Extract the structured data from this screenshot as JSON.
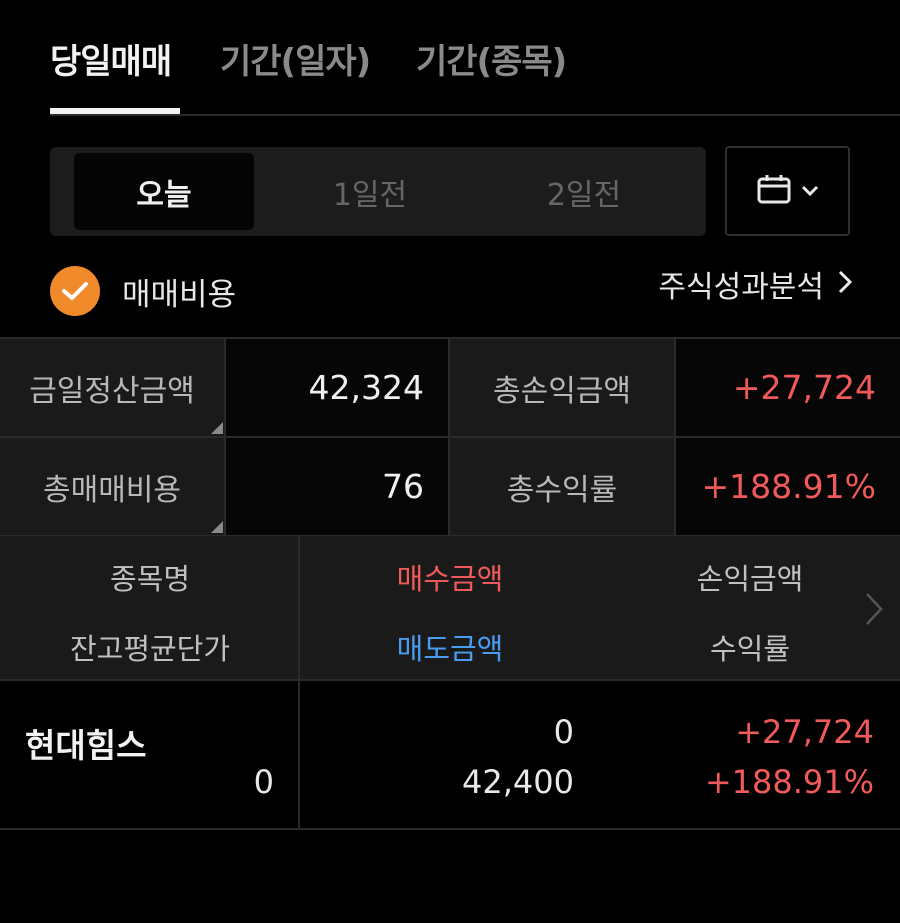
{
  "tabs": [
    {
      "label": "당일매매",
      "active": true
    },
    {
      "label": "기간(일자)",
      "active": false
    },
    {
      "label": "기간(종목)",
      "active": false
    }
  ],
  "day_selector": {
    "options": [
      "오늘",
      "1일전",
      "2일전"
    ],
    "selected": "오늘"
  },
  "calendar_button": {
    "icon": "calendar-icon",
    "chevron_icon": "chevron-down-icon"
  },
  "fee_option": {
    "label": "매매비용",
    "checked": true,
    "check_color": "#f08a2a"
  },
  "analysis_link": {
    "label": "주식성과분석",
    "icon": "chevron-right-icon"
  },
  "summary": {
    "settlement_label": "금일정산금액",
    "settlement_value": "42,324",
    "total_pnl_label": "총손익금액",
    "total_pnl_value": "+27,724",
    "total_fee_label": "총매매비용",
    "total_fee_value": "76",
    "total_return_label": "총수익률",
    "total_return_value": "+188.91%"
  },
  "list_header": {
    "col1_top": "종목명",
    "col1_bottom": "잔고평균단가",
    "col2_top": "매수금액",
    "col2_bottom": "매도금액",
    "col3_top": "손익금액",
    "col3_bottom": "수익률",
    "more_icon": "chevron-right-icon"
  },
  "rows": [
    {
      "name": "현대힘스",
      "avg_price": "0",
      "buy_amount": "0",
      "sell_amount": "42,400",
      "pnl": "+27,724",
      "return_rate": "+188.91%"
    }
  ],
  "colors": {
    "positive": "#f05a5a",
    "sell": "#4a9cf0",
    "accent": "#f08a2a"
  }
}
